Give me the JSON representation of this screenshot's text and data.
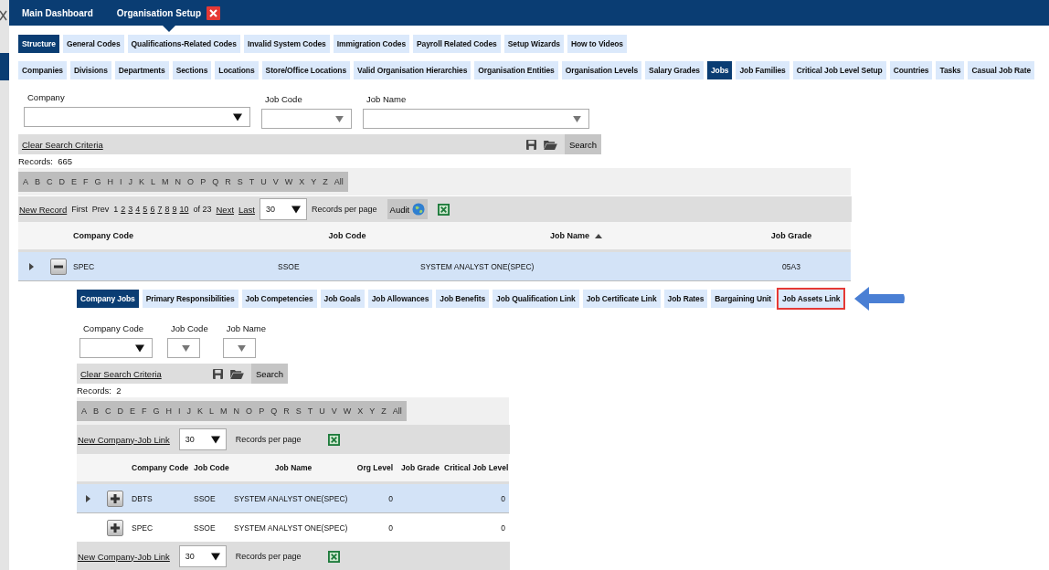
{
  "header": {
    "tabs": [
      {
        "label": "Main Dashboard",
        "selected": false,
        "closable": false
      },
      {
        "label": "Organisation Setup",
        "selected": true,
        "closable": true
      }
    ]
  },
  "category_tabs": [
    {
      "label": "Structure",
      "selected": true
    },
    {
      "label": "General Codes",
      "selected": false
    },
    {
      "label": "Qualifications-Related Codes",
      "selected": false
    },
    {
      "label": "Invalid System Codes",
      "selected": false
    },
    {
      "label": "Immigration Codes",
      "selected": false
    },
    {
      "label": "Payroll Related Codes",
      "selected": false
    },
    {
      "label": "Setup Wizards",
      "selected": false
    },
    {
      "label": "How to Videos",
      "selected": false
    }
  ],
  "sub_tabs": [
    {
      "label": "Companies",
      "selected": false
    },
    {
      "label": "Divisions",
      "selected": false
    },
    {
      "label": "Departments",
      "selected": false
    },
    {
      "label": "Sections",
      "selected": false
    },
    {
      "label": "Locations",
      "selected": false
    },
    {
      "label": "Store/Office Locations",
      "selected": false
    },
    {
      "label": "Valid Organisation Hierarchies",
      "selected": false
    },
    {
      "label": "Organisation Entities",
      "selected": false
    },
    {
      "label": "Organisation Levels",
      "selected": false
    },
    {
      "label": "Salary Grades",
      "selected": false
    },
    {
      "label": "Jobs",
      "selected": true
    },
    {
      "label": "Job Families",
      "selected": false
    },
    {
      "label": "Critical Job Level Setup",
      "selected": false
    },
    {
      "label": "Countries",
      "selected": false
    },
    {
      "label": "Tasks",
      "selected": false
    },
    {
      "label": "Casual Job Rate",
      "selected": false
    }
  ],
  "search": {
    "fields": [
      {
        "label": "Company"
      },
      {
        "label": "Job Code"
      },
      {
        "label": "Job Name"
      }
    ],
    "clear_link": "Clear Search Criteria",
    "search_button": "Search"
  },
  "records_label": "Records:",
  "records_count": "665",
  "letters": [
    "A",
    "B",
    "C",
    "D",
    "E",
    "F",
    "G",
    "H",
    "I",
    "J",
    "K",
    "L",
    "M",
    "N",
    "O",
    "P",
    "Q",
    "R",
    "S",
    "T",
    "U",
    "V",
    "W",
    "X",
    "Y",
    "Z",
    "All"
  ],
  "pager": {
    "new_record": "New Record",
    "first": "First",
    "prev": "Prev",
    "pages": [
      {
        "label": "1",
        "selected": true
      },
      {
        "label": "2",
        "selected": false
      },
      {
        "label": "3",
        "selected": false
      },
      {
        "label": "4",
        "selected": false
      },
      {
        "label": "5",
        "selected": false
      },
      {
        "label": "6",
        "selected": false
      },
      {
        "label": "7",
        "selected": false
      },
      {
        "label": "8",
        "selected": false
      },
      {
        "label": "9",
        "selected": false
      },
      {
        "label": "10",
        "selected": false
      }
    ],
    "of_text": "of 23",
    "next": "Next",
    "last": "Last",
    "per_page": "30",
    "per_page_label": "Records per page",
    "audit": "Audit"
  },
  "table": {
    "columns": [
      "Company Code",
      "Job Code",
      "Job Name",
      "Job Grade"
    ],
    "rows": [
      {
        "company_code": "SPEC",
        "job_code": "SSOE",
        "job_name": "SYSTEM ANALYST ONE(SPEC)",
        "job_grade": "05A3",
        "expanded": true,
        "selected": true
      }
    ]
  },
  "detail": {
    "tabs": [
      {
        "label": "Company Jobs",
        "selected": true,
        "highlighted": false
      },
      {
        "label": "Primary Responsibilities",
        "selected": false,
        "highlighted": false
      },
      {
        "label": "Job Competencies",
        "selected": false,
        "highlighted": false
      },
      {
        "label": "Job Goals",
        "selected": false,
        "highlighted": false
      },
      {
        "label": "Job Allowances",
        "selected": false,
        "highlighted": false
      },
      {
        "label": "Job Benefits",
        "selected": false,
        "highlighted": false
      },
      {
        "label": "Job Qualification Link",
        "selected": false,
        "highlighted": false
      },
      {
        "label": "Job Certificate Link",
        "selected": false,
        "highlighted": false
      },
      {
        "label": "Job Rates",
        "selected": false,
        "highlighted": false
      },
      {
        "label": "Bargaining Unit",
        "selected": false,
        "highlighted": false
      },
      {
        "label": "Job Assets Link",
        "selected": false,
        "highlighted": true
      }
    ],
    "search": {
      "fields": [
        {
          "label": "Company Code"
        },
        {
          "label": "Job Code"
        },
        {
          "label": "Job Name"
        }
      ],
      "clear_link": "Clear Search Criteria",
      "search_button": "Search"
    },
    "records_label": "Records:",
    "records_count": "2",
    "letters": [
      "A",
      "B",
      "C",
      "D",
      "E",
      "F",
      "G",
      "H",
      "I",
      "J",
      "K",
      "L",
      "M",
      "N",
      "O",
      "P",
      "Q",
      "R",
      "S",
      "T",
      "U",
      "V",
      "W",
      "X",
      "Y",
      "Z",
      "All"
    ],
    "new_link": "New Company-Job Link",
    "per_page": "30",
    "per_page_label": "Records per page",
    "columns": [
      "Company Code",
      "Job Code",
      "Job Name",
      "Org Level",
      "Job Grade",
      "Critical Job Level"
    ],
    "rows": [
      {
        "company_code": "DBTS",
        "job_code": "SSOE",
        "job_name": "SYSTEM ANALYST ONE(SPEC)",
        "org_level": "0",
        "job_grade": "",
        "critical_job_level": "0",
        "selected": true,
        "expanded": false
      },
      {
        "company_code": "SPEC",
        "job_code": "SSOE",
        "job_name": "SYSTEM ANALYST ONE(SPEC)",
        "org_level": "0",
        "job_grade": "",
        "critical_job_level": "0",
        "selected": false,
        "expanded": false
      }
    ],
    "footer_new_link": "New Company-Job Link",
    "footer_per_page": "30",
    "footer_per_page_label": "Records per page"
  }
}
